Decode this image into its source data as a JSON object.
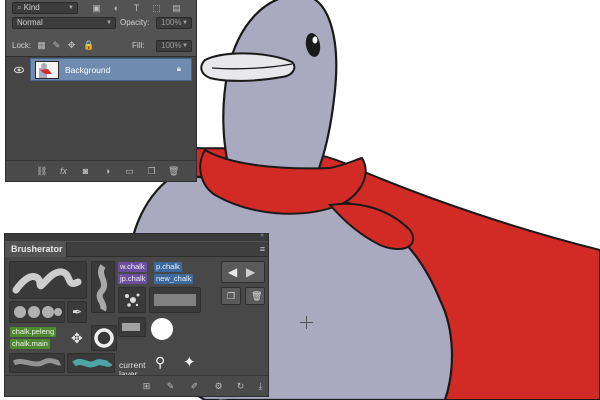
{
  "layers_panel": {
    "filter_kind": "Kind",
    "blend_mode": "Normal",
    "opacity_label": "Opacity:",
    "opacity_value": "100%",
    "lock_label": "Lock:",
    "fill_label": "Fill:",
    "fill_value": "100%",
    "layers": [
      {
        "name": "Background",
        "visible": true,
        "locked": true
      }
    ],
    "footer_icons": [
      "link-icon",
      "fx-icon",
      "mask-icon",
      "adjustment-icon",
      "folder-icon",
      "new-layer-icon",
      "trash-icon"
    ]
  },
  "brush_panel": {
    "title": "Brusherator",
    "tags": [
      {
        "text": "w.chalk",
        "color": "purple"
      },
      {
        "text": "p.chalk",
        "color": "blue"
      },
      {
        "text": "jp.chalk",
        "color": "purple"
      },
      {
        "text": "new_chalk",
        "color": "blue"
      },
      {
        "text": "chalk.peleng",
        "color": "green"
      },
      {
        "text": "chalk.main",
        "color": "green"
      }
    ],
    "current_layer_label": "current layer",
    "footer_icons": [
      "add-brush-icon",
      "edit-icon",
      "rename-icon",
      "settings-icon",
      "refresh-icon",
      "download-icon"
    ]
  },
  "colors": {
    "panel_bg": "#535353",
    "panel_dark": "#3a3a3a",
    "selection_blue": "#6f8bb0",
    "cape_red": "#d22a25",
    "bird_body": "#a9a9bf"
  }
}
